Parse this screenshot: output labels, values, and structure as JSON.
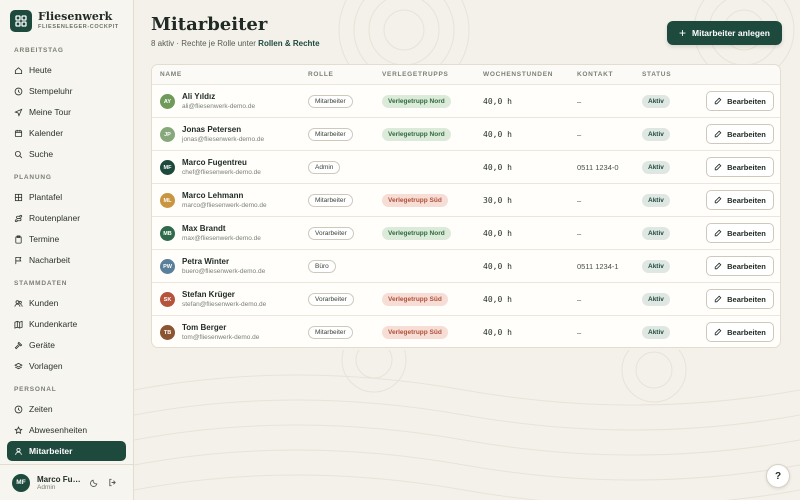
{
  "brand": {
    "name": "Fliesenwerk",
    "subtitle": "FLIESENLEGER-COCKPIT"
  },
  "sidebar": {
    "sections": [
      {
        "label": "ARBEITSTAG",
        "items": [
          {
            "label": "Heute",
            "icon": "home-icon"
          },
          {
            "label": "Stempeluhr",
            "icon": "clock-icon"
          },
          {
            "label": "Meine Tour",
            "icon": "navigation-icon"
          },
          {
            "label": "Kalender",
            "icon": "calendar-icon"
          },
          {
            "label": "Suche",
            "icon": "search-icon"
          }
        ]
      },
      {
        "label": "PLANUNG",
        "items": [
          {
            "label": "Plantafel",
            "icon": "grid-icon"
          },
          {
            "label": "Routenplaner",
            "icon": "route-icon"
          },
          {
            "label": "Termine",
            "icon": "clipboard-icon"
          },
          {
            "label": "Nacharbeit",
            "icon": "flag-icon"
          }
        ]
      },
      {
        "label": "STAMMDATEN",
        "items": [
          {
            "label": "Kunden",
            "icon": "users-icon"
          },
          {
            "label": "Kundenkarte",
            "icon": "map-icon"
          },
          {
            "label": "Geräte",
            "icon": "hammer-icon"
          },
          {
            "label": "Vorlagen",
            "icon": "layers-icon"
          }
        ]
      },
      {
        "label": "PERSONAL",
        "items": [
          {
            "label": "Zeiten",
            "icon": "clock-icon"
          },
          {
            "label": "Abwesenheiten",
            "icon": "star-icon"
          },
          {
            "label": "Mitarbeiter",
            "icon": "user-icon",
            "active": true
          }
        ]
      }
    ],
    "user": {
      "initials": "MF",
      "name": "Marco Fugentreu",
      "role": "Admin"
    }
  },
  "header": {
    "title": "Mitarbeiter",
    "subtitle_prefix": "8 aktiv · Rechte je Rolle unter ",
    "subtitle_link": "Rollen & Rechte",
    "primary_button": "Mitarbeiter anlegen"
  },
  "table": {
    "columns": [
      "NAME",
      "ROLLE",
      "VERLEGETRUPPS",
      "WOCHENSTUNDEN",
      "KONTAKT",
      "STATUS"
    ],
    "edit_label": "Bearbeiten",
    "rows": [
      {
        "initials": "AY",
        "avatar_color": "#6f9a5a",
        "name": "Ali Yıldız",
        "email": "ali@fliesenwerk-demo.de",
        "role": "Mitarbeiter",
        "trupp": "Verlegetrupp Nord",
        "trupp_type": "nord",
        "hours": "40,0 h",
        "contact": "–",
        "status": "Aktiv"
      },
      {
        "initials": "JP",
        "avatar_color": "#87a87a",
        "name": "Jonas Petersen",
        "email": "jonas@fliesenwerk-demo.de",
        "role": "Mitarbeiter",
        "trupp": "Verlegetrupp Nord",
        "trupp_type": "nord",
        "hours": "40,0 h",
        "contact": "–",
        "status": "Aktiv"
      },
      {
        "initials": "MF",
        "avatar_color": "#1e4a3e",
        "name": "Marco Fugentreu",
        "email": "chef@fliesenwerk-demo.de",
        "role": "Admin",
        "trupp": "",
        "trupp_type": "",
        "hours": "40,0 h",
        "contact": "0511 1234-0",
        "status": "Aktiv"
      },
      {
        "initials": "ML",
        "avatar_color": "#c9953f",
        "name": "Marco Lehmann",
        "email": "marco@fliesenwerk-demo.de",
        "role": "Mitarbeiter",
        "trupp": "Verlegetrupp Süd",
        "trupp_type": "sued",
        "hours": "30,0 h",
        "contact": "–",
        "status": "Aktiv"
      },
      {
        "initials": "MB",
        "avatar_color": "#2f6a4b",
        "name": "Max Brandt",
        "email": "max@fliesenwerk-demo.de",
        "role": "Vorarbeiter",
        "trupp": "Verlegetrupp Nord",
        "trupp_type": "nord",
        "hours": "40,0 h",
        "contact": "–",
        "status": "Aktiv"
      },
      {
        "initials": "PW",
        "avatar_color": "#5a7f9a",
        "name": "Petra Winter",
        "email": "buero@fliesenwerk-demo.de",
        "role": "Büro",
        "trupp": "",
        "trupp_type": "",
        "hours": "40,0 h",
        "contact": "0511 1234-1",
        "status": "Aktiv"
      },
      {
        "initials": "SK",
        "avatar_color": "#b5533c",
        "name": "Stefan Krüger",
        "email": "stefan@fliesenwerk-demo.de",
        "role": "Vorarbeiter",
        "trupp": "Verlegetrupp Süd",
        "trupp_type": "sued",
        "hours": "40,0 h",
        "contact": "–",
        "status": "Aktiv"
      },
      {
        "initials": "TB",
        "avatar_color": "#8a5530",
        "name": "Tom Berger",
        "email": "tom@fliesenwerk-demo.de",
        "role": "Mitarbeiter",
        "trupp": "Verlegetrupp Süd",
        "trupp_type": "sued",
        "hours": "40,0 h",
        "contact": "–",
        "status": "Aktiv"
      }
    ]
  },
  "help": {
    "label": "?"
  }
}
